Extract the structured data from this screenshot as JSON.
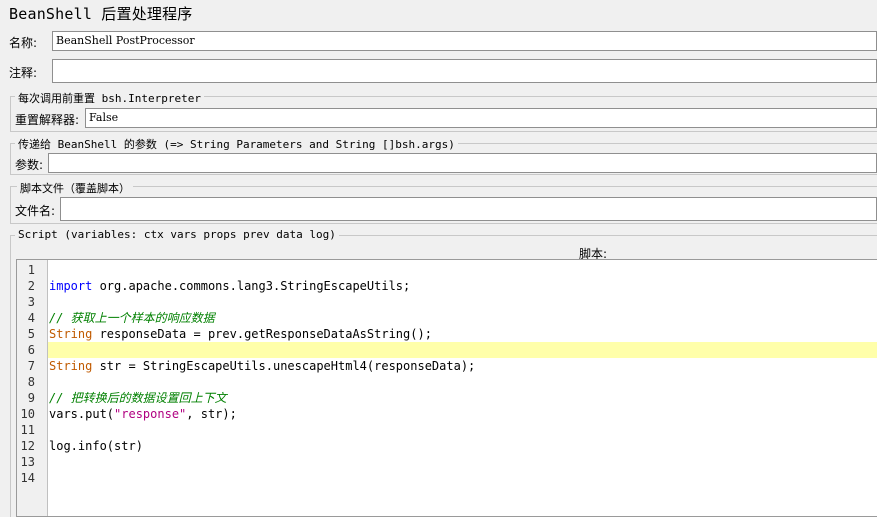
{
  "panel": {
    "title": "BeanShell 后置处理程序"
  },
  "name_row": {
    "label": "名称:",
    "value": "BeanShell PostProcessor"
  },
  "comment_row": {
    "label": "注释:",
    "value": ""
  },
  "reset_group": {
    "legend": "每次调用前重置 bsh.Interpreter",
    "label": "重置解释器:",
    "value": "False"
  },
  "params_group": {
    "legend": "传递给 BeanShell 的参数 (=> String Parameters and String []bsh.args)",
    "label": "参数:",
    "value": ""
  },
  "file_group": {
    "legend": "脚本文件（覆盖脚本）",
    "label": "文件名:",
    "value": ""
  },
  "script_group": {
    "legend": "Script (variables: ctx vars props prev data log)",
    "header": "脚本:"
  },
  "editor": {
    "current_line": 6,
    "lines": [
      {
        "n": "1",
        "tokens": []
      },
      {
        "n": "2",
        "tokens": [
          {
            "t": "import",
            "c": "kw"
          },
          {
            "t": " org.apache.commons.lang3.StringEscapeUtils;",
            "c": ""
          }
        ]
      },
      {
        "n": "3",
        "tokens": []
      },
      {
        "n": "4",
        "tokens": [
          {
            "t": "// 获取上一个样本的响应数据",
            "c": "cm"
          }
        ]
      },
      {
        "n": "5",
        "tokens": [
          {
            "t": "String",
            "c": "type"
          },
          {
            "t": " responseData = prev.getResponseDataAsString();",
            "c": ""
          }
        ]
      },
      {
        "n": "6",
        "tokens": []
      },
      {
        "n": "7",
        "tokens": [
          {
            "t": "String",
            "c": "type"
          },
          {
            "t": " str = StringEscapeUtils.unescapeHtml4(responseData);",
            "c": ""
          }
        ]
      },
      {
        "n": "8",
        "tokens": []
      },
      {
        "n": "9",
        "tokens": [
          {
            "t": "// 把转换后的数据设置回上下文",
            "c": "cm"
          }
        ]
      },
      {
        "n": "10",
        "tokens": [
          {
            "t": "vars.put(",
            "c": ""
          },
          {
            "t": "\"response\"",
            "c": "str"
          },
          {
            "t": ", str);",
            "c": ""
          }
        ]
      },
      {
        "n": "11",
        "tokens": []
      },
      {
        "n": "12",
        "tokens": [
          {
            "t": "log.info(str)",
            "c": ""
          }
        ]
      },
      {
        "n": "13",
        "tokens": []
      },
      {
        "n": "14",
        "tokens": []
      }
    ]
  }
}
